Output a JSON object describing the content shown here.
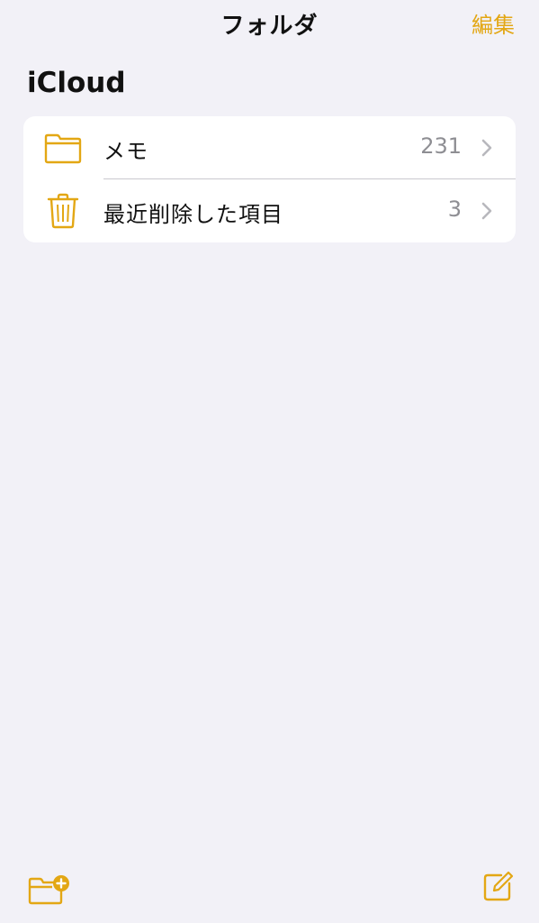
{
  "nav": {
    "title": "フォルダ",
    "edit_label": "編集"
  },
  "section": {
    "title": "iCloud"
  },
  "folders": [
    {
      "label": "メモ",
      "count": "231",
      "icon": "folder-icon"
    },
    {
      "label": "最近削除した項目",
      "count": "3",
      "icon": "trash-icon"
    }
  ],
  "toolbar": {
    "new_folder_icon": "new-folder-icon",
    "compose_icon": "compose-icon"
  },
  "colors": {
    "accent": "#e3a714",
    "background": "#f2f1f7",
    "card": "#ffffff",
    "secondary_text": "#8e8e93",
    "separator": "#c9c8ce"
  }
}
